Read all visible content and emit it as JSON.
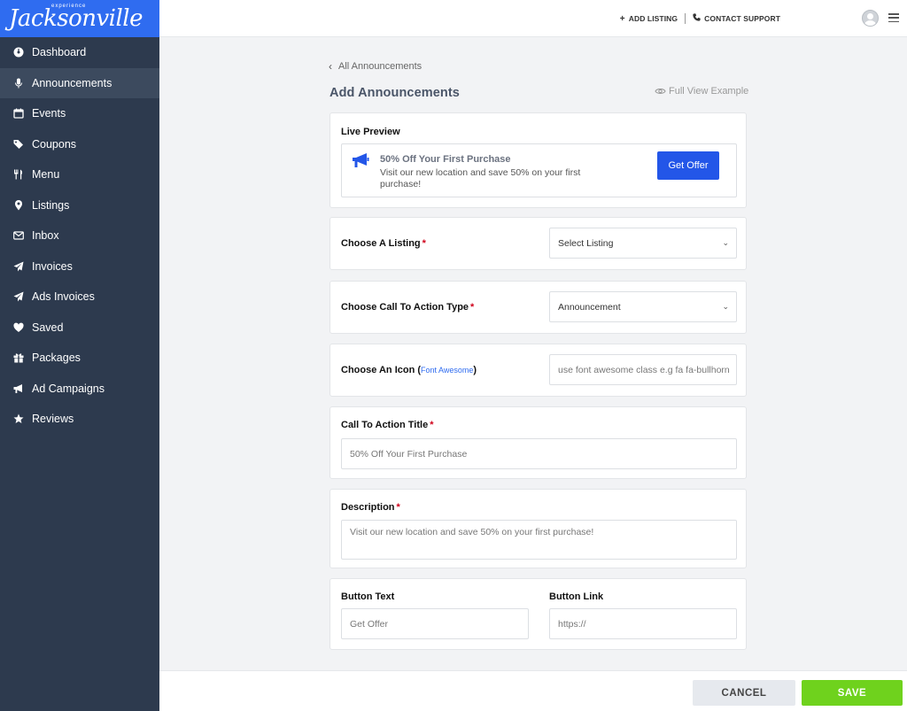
{
  "brand": {
    "logo_text": "Jacksonville",
    "logo_prefix": "experience"
  },
  "sidebar": {
    "items": [
      {
        "label": "Dashboard",
        "icon": "dashboard-icon"
      },
      {
        "label": "Announcements",
        "icon": "microphone-icon",
        "active": true
      },
      {
        "label": "Events",
        "icon": "calendar-icon"
      },
      {
        "label": "Coupons",
        "icon": "tags-icon"
      },
      {
        "label": "Menu",
        "icon": "utensils-icon"
      },
      {
        "label": "Listings",
        "icon": "map-marker-icon"
      },
      {
        "label": "Inbox",
        "icon": "envelope-icon"
      },
      {
        "label": "Invoices",
        "icon": "paper-plane-icon"
      },
      {
        "label": "Ads Invoices",
        "icon": "paper-plane-icon"
      },
      {
        "label": "Saved",
        "icon": "heart-icon"
      },
      {
        "label": "Packages",
        "icon": "gift-icon"
      },
      {
        "label": "Ad Campaigns",
        "icon": "bullhorn-icon"
      },
      {
        "label": "Reviews",
        "icon": "star-icon"
      }
    ]
  },
  "topbar": {
    "add_listing": "ADD LISTING",
    "contact_support": "CONTACT SUPPORT"
  },
  "main": {
    "back_link": "All Announcements",
    "title": "Add Announcements",
    "full_view": "Full View Example"
  },
  "preview": {
    "label": "Live Preview",
    "title": "50% Off Your First Purchase",
    "description": "Visit our new location and save 50% on your first purchase!",
    "button": "Get Offer"
  },
  "form": {
    "listing": {
      "label": "Choose A Listing",
      "value": "Select Listing"
    },
    "cta_type": {
      "label": "Choose Call To Action Type",
      "value": "Announcement"
    },
    "icon": {
      "label": "Choose An Icon (",
      "link": "Font Awesome",
      "label_end": ")",
      "placeholder": "use font awesome class e.g fa fa-bullhorn"
    },
    "cta_title": {
      "label": "Call To Action Title",
      "value": "50% Off Your First Purchase"
    },
    "description": {
      "label": "Description",
      "value": "Visit our new location and save 50% on your first purchase!"
    },
    "button_text": {
      "label": "Button Text",
      "value": "Get Offer"
    },
    "button_link": {
      "label": "Button Link",
      "value": "https://"
    }
  },
  "footer": {
    "cancel": "CANCEL",
    "save": "SAVE"
  },
  "colors": {
    "brand_blue": "#2f6cf0",
    "sidebar_bg": "#2d3a4e",
    "save_green": "#6fd21d",
    "required_red": "#d0021b"
  }
}
